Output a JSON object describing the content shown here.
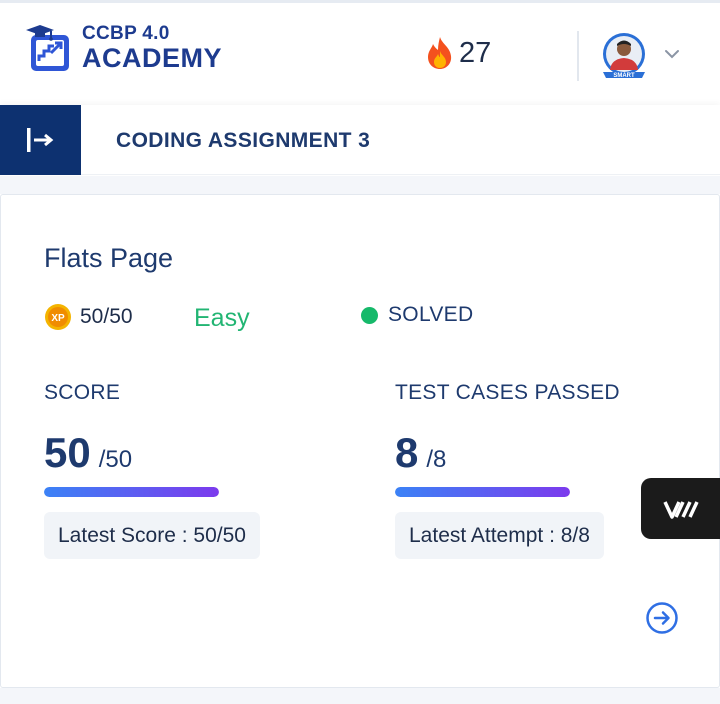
{
  "header": {
    "logo": {
      "line1": "CCBP 4.0",
      "line2": "ACADEMY",
      "icon": "academy-logo-icon"
    },
    "streak": {
      "icon": "fire-icon",
      "count": "27"
    },
    "profile": {
      "avatar_badge": "SMART",
      "dropdown_icon": "chevron-down-icon"
    }
  },
  "subheader": {
    "toggle_icon": "sidebar-toggle-icon",
    "title": "CODING ASSIGNMENT 3"
  },
  "question": {
    "title": "Flats Page",
    "xp": {
      "icon": "xp-coin-icon",
      "coin_label": "XP",
      "value": "50/50"
    },
    "difficulty": "Easy",
    "status": "SOLVED",
    "score": {
      "label": "SCORE",
      "value": "50",
      "max": "/50",
      "progress": 1.0,
      "latest": "Latest Score : 50/50"
    },
    "tests": {
      "label": "TEST CASES PASSED",
      "value": "8",
      "max": "/8",
      "progress": 1.0,
      "latest": "Latest Attempt : 8/8"
    },
    "next_icon": "arrow-right-circle-icon"
  },
  "floating_button": {
    "icon": "w-logo-icon"
  },
  "colors": {
    "brand_navy": "#0d3170",
    "text_navy": "#1e3a6e",
    "easy_green": "#22b573",
    "solved_green": "#16b96a",
    "progress_start": "#3b82f6",
    "progress_end": "#7c3aed"
  }
}
